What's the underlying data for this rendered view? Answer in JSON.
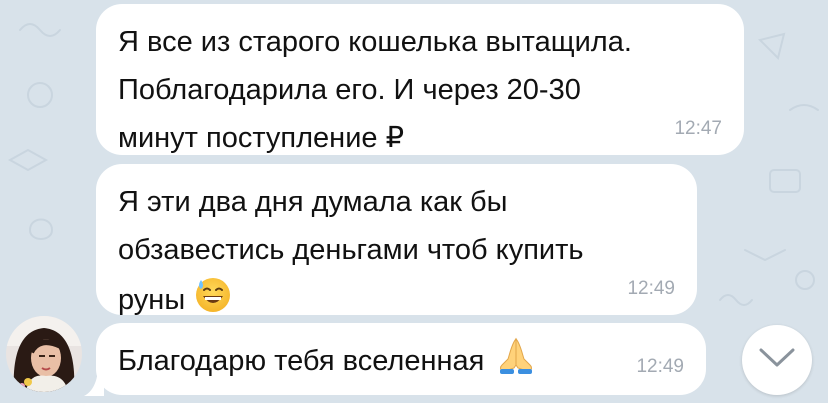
{
  "messages": [
    {
      "text": "Я все из старого кошелька вытащила.\nПоблагодарила его. И через 20-30\nминут поступление ₽",
      "time": "12:47"
    },
    {
      "text": "Я эти два дня думала как бы\nобзавестись деньгами чтоб купить\nруны",
      "emoji": "grinning-face-with-sweat-emoji",
      "time": "12:49"
    },
    {
      "text": "Благодарю тебя вселенная",
      "emoji": "folded-hands-emoji",
      "time": "12:49"
    }
  ],
  "icons": {
    "scroll_down": "chevron-down-icon"
  },
  "colors": {
    "wallpaper": "#d8e2ea",
    "bubble": "#ffffff",
    "text": "#111111",
    "timestamp": "#a3aab3"
  }
}
